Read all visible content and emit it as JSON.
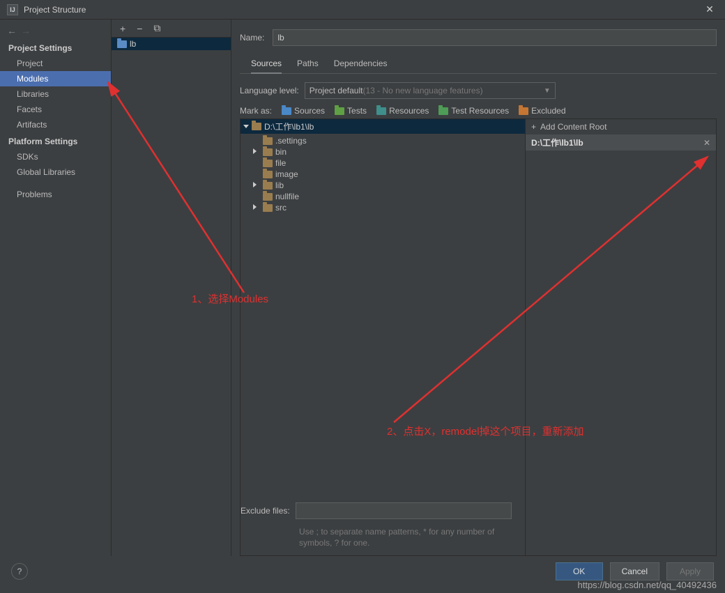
{
  "window": {
    "title": "Project Structure"
  },
  "sidebar": {
    "project_settings_heading": "Project Settings",
    "platform_settings_heading": "Platform Settings",
    "items": {
      "project": "Project",
      "modules": "Modules",
      "libraries": "Libraries",
      "facets": "Facets",
      "artifacts": "Artifacts",
      "sdks": "SDKs",
      "global_libraries": "Global Libraries",
      "problems": "Problems"
    }
  },
  "modules_list": {
    "module": "lb"
  },
  "detail": {
    "name_label": "Name:",
    "name_value": "lb",
    "tabs": {
      "sources": "Sources",
      "paths": "Paths",
      "dependencies": "Dependencies"
    },
    "language_level_label": "Language level:",
    "language_level_value": "Project default ",
    "language_level_hint": "(13 - No new language features)",
    "mark_as_label": "Mark as:",
    "mark_items": {
      "sources": "Sources",
      "tests": "Tests",
      "resources": "Resources",
      "test_resources": "Test Resources",
      "excluded": "Excluded"
    },
    "tree_root": "D:\\工作\\lb1\\lb",
    "tree_children": [
      {
        "name": ".settings",
        "expandable": false
      },
      {
        "name": "bin",
        "expandable": true
      },
      {
        "name": "file",
        "expandable": false
      },
      {
        "name": "image",
        "expandable": false
      },
      {
        "name": "lib",
        "expandable": true
      },
      {
        "name": "nullfile",
        "expandable": false
      },
      {
        "name": "src",
        "expandable": true
      }
    ],
    "add_content_root": "Add Content Root",
    "content_root_path": "D:\\工作\\lb1\\lb",
    "exclude_label": "Exclude files:",
    "exclude_hint": "Use ; to separate name patterns, * for any number of symbols, ? for one."
  },
  "buttons": {
    "ok": "OK",
    "cancel": "Cancel",
    "apply": "Apply"
  },
  "annotations": {
    "a1": "1、选择Modules",
    "a2": "2、点击X，remodel掉这个项目，重新添加"
  },
  "watermark": "https://blog.csdn.net/qq_40492436"
}
